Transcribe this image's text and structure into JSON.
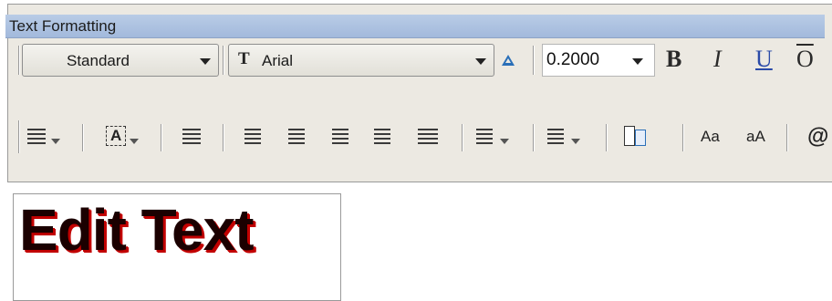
{
  "window": {
    "title": "Text Formatting"
  },
  "row1": {
    "style": "Standard",
    "font": "Arial",
    "text_height": "0.2000",
    "bold_label": "B",
    "italic_label": "I",
    "underline_label": "U",
    "overline_label": "O"
  },
  "row2": {
    "uppercase_label": "Aa",
    "lowercase_label": "aA",
    "symbol_label": "@"
  },
  "canvas": {
    "text": "Edit Text"
  },
  "colors": {
    "title_bar": "#a2b9dc",
    "text_fill": "#1b0000",
    "text_shadow": "#c20000",
    "annotative": "#2a6fb8"
  }
}
